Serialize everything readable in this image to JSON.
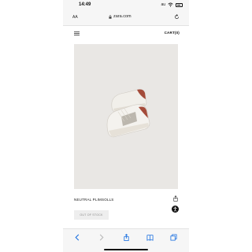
{
  "status_bar": {
    "time": "14:49",
    "carrier": "au"
  },
  "browser": {
    "text_size_label": "AA",
    "url": "zara.com"
  },
  "header": {
    "cart_label": "CART(0)"
  },
  "product": {
    "name": "NEUTRAL PLIMSOLLS",
    "stock_button": "OUT OF STOCK"
  },
  "colors": {
    "accent": "#1a6fe0",
    "image_background": "#e9e7e4",
    "shoe_heel": "#a44b3a"
  },
  "icons": {
    "toolbar": [
      "back-icon",
      "forward-icon",
      "share-icon",
      "bookmarks-icon",
      "tabs-icon"
    ]
  }
}
